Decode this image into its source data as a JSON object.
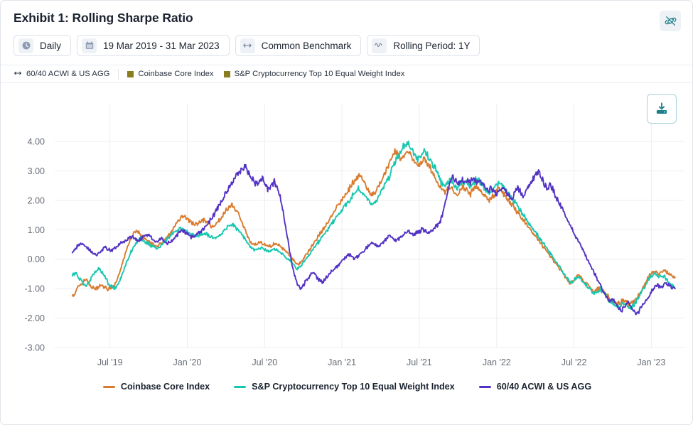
{
  "header": {
    "title": "Exhibit 1: Rolling Sharpe Ratio",
    "unlink_icon": "broken-link-icon"
  },
  "toolbar": {
    "buttons": [
      {
        "label": "Daily",
        "icon": "clock-icon"
      },
      {
        "label": "19 Mar 2019 - 31 Mar 2023",
        "icon": "calendar-icon"
      },
      {
        "label": "Common Benchmark",
        "icon": "arrows-horizontal-icon"
      },
      {
        "label": "Rolling Period: 1Y",
        "icon": "wave-icon"
      }
    ]
  },
  "top_legend": {
    "benchmark": {
      "label": "60/40 ACWI & US AGG",
      "icon": "arrows-horizontal-icon"
    },
    "items": [
      {
        "label": "Coinbase Core Index",
        "swatch": "#8a7d1e"
      },
      {
        "label": "S&P Cryptocurrency Top 10 Equal Weight Index",
        "swatch": "#8a7d1e"
      }
    ]
  },
  "actions": {
    "download_label": "download-icon"
  },
  "colors": {
    "coinbase": "#d97b2e",
    "sp_crypto": "#19c7b0",
    "benchmark": "#5333c4",
    "grid": "#ededf0",
    "axis_text": "#666c75",
    "teal_accent": "#1b7f8c"
  },
  "chart_data": {
    "type": "line",
    "title": "Exhibit 1: Rolling Sharpe Ratio",
    "xlabel": "",
    "ylabel": "",
    "grid": true,
    "legend_position": "bottom",
    "ylim": [
      -3.0,
      4.0
    ],
    "ytick_labels": [
      "4.00",
      "3.00",
      "2.00",
      "1.00",
      "0.00",
      "-1.00",
      "-2.00",
      "-3.00"
    ],
    "ytick_values": [
      4.0,
      3.0,
      2.0,
      1.0,
      0.0,
      -1.0,
      -2.0,
      -3.0
    ],
    "xtick_labels": [
      "Jul '19",
      "Jan '20",
      "Jul '20",
      "Jan '21",
      "Jul '21",
      "Jan '22",
      "Jul '22",
      "Jan '23"
    ],
    "xtick_positions": [
      0.0877,
      0.2105,
      0.3333,
      0.4561,
      0.5789,
      0.7018,
      0.8246,
      0.9474
    ],
    "x_range_label": "19 Mar 2019 - 31 Mar 2023",
    "series": [
      {
        "name": "Coinbase Core Index",
        "color": "#d97b2e",
        "values": [
          -1.22,
          -1.1,
          -0.92,
          -0.8,
          -0.68,
          -0.8,
          -0.95,
          -1.02,
          -0.95,
          -0.88,
          -0.95,
          -1.02,
          -0.98,
          -0.9,
          -0.6,
          -0.25,
          0.1,
          0.45,
          0.72,
          0.9,
          0.98,
          0.82,
          0.7,
          0.62,
          0.55,
          0.5,
          0.46,
          0.52,
          0.6,
          0.72,
          0.88,
          1.05,
          1.22,
          1.38,
          1.48,
          1.42,
          1.3,
          1.22,
          1.18,
          1.26,
          1.34,
          1.3,
          1.2,
          1.12,
          1.18,
          1.3,
          1.46,
          1.62,
          1.78,
          1.85,
          1.7,
          1.52,
          1.3,
          1.0,
          0.72,
          0.55,
          0.48,
          0.52,
          0.58,
          0.5,
          0.42,
          0.45,
          0.52,
          0.48,
          0.4,
          0.3,
          0.22,
          0.1,
          -0.05,
          -0.18,
          -0.12,
          0.02,
          0.18,
          0.35,
          0.52,
          0.7,
          0.85,
          1.0,
          1.18,
          1.35,
          1.55,
          1.72,
          1.88,
          2.05,
          2.22,
          2.4,
          2.58,
          2.72,
          2.85,
          2.7,
          2.5,
          2.3,
          2.15,
          2.3,
          2.5,
          2.72,
          2.92,
          3.15,
          3.4,
          3.7,
          3.55,
          3.38,
          3.55,
          3.7,
          3.5,
          3.3,
          3.15,
          3.3,
          3.45,
          3.25,
          3.1,
          2.9,
          2.65,
          2.4,
          2.25,
          2.35,
          2.45,
          2.3,
          2.15,
          2.3,
          2.45,
          2.35,
          2.2,
          2.35,
          2.5,
          2.4,
          2.25,
          2.1,
          2.0,
          2.12,
          2.25,
          2.4,
          2.3,
          2.15,
          2.0,
          1.85,
          1.7,
          1.55,
          1.4,
          1.25,
          1.1,
          0.95,
          0.8,
          0.65,
          0.5,
          0.35,
          0.2,
          0.05,
          -0.1,
          -0.25,
          -0.4,
          -0.55,
          -0.7,
          -0.85,
          -0.7,
          -0.55,
          -0.6,
          -0.75,
          -0.85,
          -0.95,
          -1.1,
          -1.05,
          -0.95,
          -1.05,
          -1.2,
          -1.35,
          -1.45,
          -1.55,
          -1.5,
          -1.4,
          -1.45,
          -1.55,
          -1.48,
          -1.35,
          -1.2,
          -1.0,
          -0.75,
          -0.55,
          -0.45,
          -0.4,
          -0.5,
          -0.42,
          -0.38,
          -0.48,
          -0.55,
          -0.62
        ]
      },
      {
        "name": "S&P Cryptocurrency Top 10 Equal Weight Index",
        "color": "#19c7b0",
        "values": [
          -0.55,
          -0.48,
          -0.62,
          -0.78,
          -0.9,
          -0.8,
          -0.62,
          -0.45,
          -0.3,
          -0.42,
          -0.6,
          -0.8,
          -0.95,
          -1.0,
          -0.85,
          -0.6,
          -0.3,
          0.0,
          0.25,
          0.45,
          0.62,
          0.7,
          0.62,
          0.55,
          0.48,
          0.42,
          0.38,
          0.45,
          0.55,
          0.68,
          0.8,
          0.9,
          0.98,
          1.05,
          1.02,
          0.95,
          0.88,
          0.82,
          0.78,
          0.82,
          0.88,
          0.85,
          0.78,
          0.72,
          0.75,
          0.82,
          0.92,
          1.02,
          1.12,
          1.18,
          1.1,
          0.98,
          0.85,
          0.68,
          0.5,
          0.38,
          0.32,
          0.35,
          0.4,
          0.32,
          0.25,
          0.28,
          0.35,
          0.3,
          0.22,
          0.12,
          0.02,
          -0.08,
          -0.2,
          -0.32,
          -0.25,
          -0.12,
          0.02,
          0.18,
          0.35,
          0.5,
          0.65,
          0.8,
          0.95,
          1.1,
          1.28,
          1.42,
          1.55,
          1.7,
          1.85,
          2.0,
          2.15,
          2.28,
          2.4,
          2.28,
          2.12,
          1.95,
          1.82,
          1.95,
          2.15,
          2.35,
          2.55,
          2.75,
          3.0,
          3.3,
          3.55,
          3.7,
          3.85,
          3.95,
          3.75,
          3.55,
          3.42,
          3.55,
          3.7,
          3.52,
          3.35,
          3.15,
          2.9,
          2.65,
          2.48,
          2.58,
          2.68,
          2.55,
          2.42,
          2.55,
          2.68,
          2.58,
          2.45,
          2.58,
          2.7,
          2.62,
          2.48,
          2.35,
          2.25,
          2.35,
          2.48,
          2.6,
          2.5,
          2.35,
          2.2,
          2.05,
          1.9,
          1.75,
          1.58,
          1.42,
          1.26,
          1.1,
          0.94,
          0.78,
          0.62,
          0.46,
          0.3,
          0.14,
          -0.02,
          -0.18,
          -0.34,
          -0.5,
          -0.66,
          -0.82,
          -0.7,
          -0.58,
          -0.66,
          -0.8,
          -0.92,
          -1.02,
          -1.18,
          -1.12,
          -1.02,
          -1.12,
          -1.28,
          -1.42,
          -1.52,
          -1.62,
          -1.58,
          -1.48,
          -1.55,
          -1.68,
          -1.6,
          -1.45,
          -1.28,
          -1.08,
          -0.85,
          -0.65,
          -0.55,
          -0.5,
          -0.6,
          -0.55,
          -0.62,
          -0.78,
          -0.9,
          -1.0
        ]
      },
      {
        "name": "60/40 ACWI & US AGG",
        "color": "#5333c4",
        "values": [
          0.2,
          0.35,
          0.48,
          0.55,
          0.48,
          0.38,
          0.28,
          0.2,
          0.15,
          0.22,
          0.32,
          0.4,
          0.35,
          0.28,
          0.35,
          0.45,
          0.52,
          0.58,
          0.65,
          0.72,
          0.78,
          0.7,
          0.62,
          0.68,
          0.78,
          0.85,
          0.78,
          0.68,
          0.58,
          0.62,
          0.7,
          0.62,
          0.55,
          0.58,
          0.68,
          0.8,
          0.92,
          1.0,
          0.92,
          0.82,
          0.75,
          0.8,
          0.88,
          0.95,
          1.02,
          1.12,
          1.25,
          1.4,
          1.58,
          1.75,
          1.92,
          2.1,
          2.28,
          2.45,
          2.62,
          2.78,
          2.92,
          3.05,
          3.15,
          3.0,
          2.82,
          2.68,
          2.55,
          2.62,
          2.72,
          2.55,
          2.35,
          2.5,
          2.62,
          2.42,
          2.1,
          1.6,
          1.0,
          0.4,
          -0.2,
          -0.6,
          -0.9,
          -0.98,
          -0.85,
          -0.7,
          -0.55,
          -0.45,
          -0.55,
          -0.68,
          -0.78,
          -0.7,
          -0.58,
          -0.45,
          -0.35,
          -0.25,
          -0.15,
          -0.05,
          0.05,
          0.15,
          0.1,
          0.02,
          0.08,
          0.18,
          0.28,
          0.38,
          0.48,
          0.58,
          0.5,
          0.42,
          0.5,
          0.62,
          0.72,
          0.8,
          0.72,
          0.62,
          0.7,
          0.8,
          0.88,
          0.95,
          0.88,
          0.82,
          0.88,
          0.95,
          1.02,
          0.95,
          0.88,
          0.95,
          1.05,
          1.15,
          1.3,
          1.6,
          2.1,
          2.55,
          2.8,
          2.7,
          2.6,
          2.72,
          2.6,
          2.72,
          2.62,
          2.72,
          2.6,
          2.68,
          2.58,
          2.45,
          2.35,
          2.42,
          2.3,
          2.2,
          2.32,
          2.45,
          2.3,
          2.18,
          2.05,
          2.25,
          2.45,
          2.3,
          2.15,
          2.32,
          2.5,
          2.7,
          2.9,
          3.0,
          2.8,
          2.55,
          2.4,
          2.55,
          2.35,
          2.1,
          1.9,
          1.7,
          1.5,
          1.3,
          1.1,
          0.9,
          0.7,
          0.5,
          0.3,
          0.1,
          -0.1,
          -0.3,
          -0.5,
          -0.7,
          -0.9,
          -1.1,
          -1.3,
          -1.45,
          -1.35,
          -1.5,
          -1.65,
          -1.78,
          -1.6,
          -1.5,
          -1.6,
          -1.75,
          -1.88,
          -1.75,
          -1.6,
          -1.45,
          -1.3,
          -1.1,
          -0.95,
          -0.88,
          -0.95,
          -0.88,
          -0.82,
          -0.9,
          -0.95,
          -1.0
        ]
      }
    ]
  },
  "bottom_legend": [
    {
      "label": "Coinbase Core Index",
      "color": "#d97b2e"
    },
    {
      "label": "S&P Cryptocurrency Top 10 Equal Weight Index",
      "color": "#19c7b0"
    },
    {
      "label": "60/40 ACWI & US AGG",
      "color": "#5333c4"
    }
  ]
}
